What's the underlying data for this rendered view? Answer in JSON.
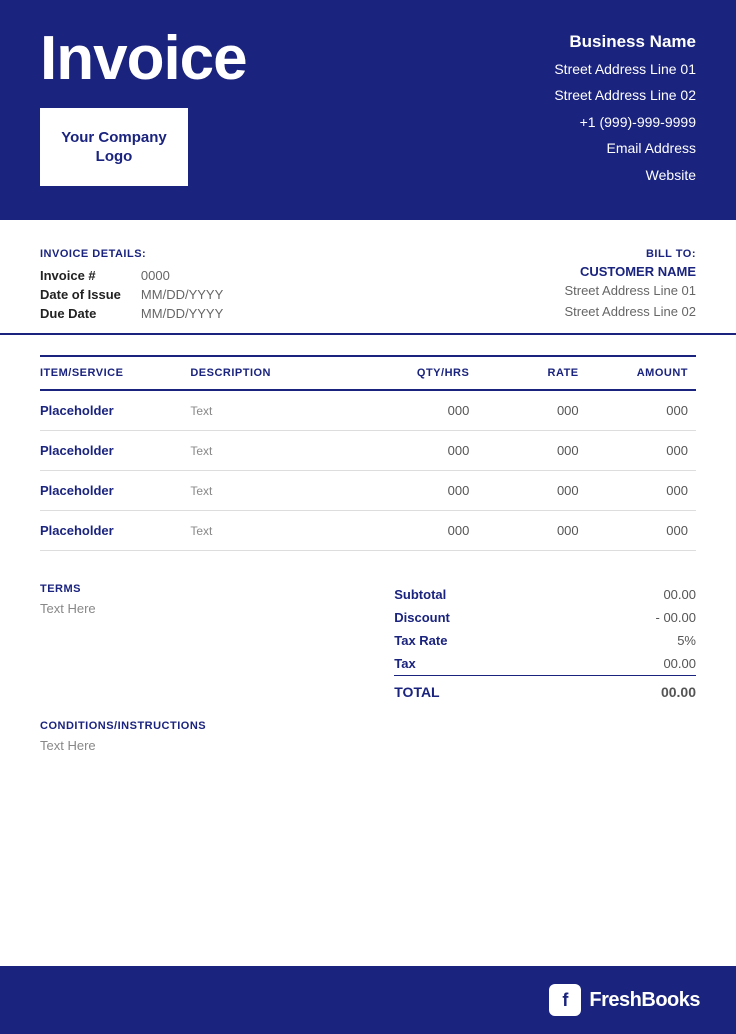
{
  "header": {
    "invoice_title": "Invoice",
    "logo_text": "Your Company Logo",
    "business_name": "Business Name",
    "address_line1": "Street Address Line 01",
    "address_line2": "Street Address Line 02",
    "phone": "+1 (999)-999-9999",
    "email": "Email Address",
    "website": "Website"
  },
  "invoice_details": {
    "section_label": "INVOICE DETAILS:",
    "fields": [
      {
        "label": "Invoice #",
        "value": "0000"
      },
      {
        "label": "Date of Issue",
        "value": "MM/DD/YYYY"
      },
      {
        "label": "Due Date",
        "value": "MM/DD/YYYY"
      }
    ]
  },
  "bill_to": {
    "label": "BILL TO:",
    "customer_name": "CUSTOMER NAME",
    "address_line1": "Street Address Line 01",
    "address_line2": "Street Address Line 02"
  },
  "items_table": {
    "columns": [
      "ITEM/SERVICE",
      "DESCRIPTION",
      "QTY/HRS",
      "RATE",
      "AMOUNT"
    ],
    "rows": [
      {
        "name": "Placeholder",
        "desc": "Text",
        "qty": "000",
        "rate": "000",
        "amount": "000"
      },
      {
        "name": "Placeholder",
        "desc": "Text",
        "qty": "000",
        "rate": "000",
        "amount": "000"
      },
      {
        "name": "Placeholder",
        "desc": "Text",
        "qty": "000",
        "rate": "000",
        "amount": "000"
      },
      {
        "name": "Placeholder",
        "desc": "Text",
        "qty": "000",
        "rate": "000",
        "amount": "000"
      }
    ]
  },
  "terms": {
    "label": "TERMS",
    "text": "Text Here"
  },
  "totals": {
    "subtotal_label": "Subtotal",
    "subtotal_value": "00.00",
    "discount_label": "Discount",
    "discount_value": "- 00.00",
    "taxrate_label": "Tax Rate",
    "taxrate_value": "5%",
    "tax_label": "Tax",
    "tax_value": "00.00",
    "total_label": "TOTAL",
    "total_value": "00.00"
  },
  "conditions": {
    "label": "CONDITIONS/INSTRUCTIONS",
    "text": "Text Here"
  },
  "footer": {
    "brand": "FreshBooks",
    "icon_letter": "f"
  }
}
